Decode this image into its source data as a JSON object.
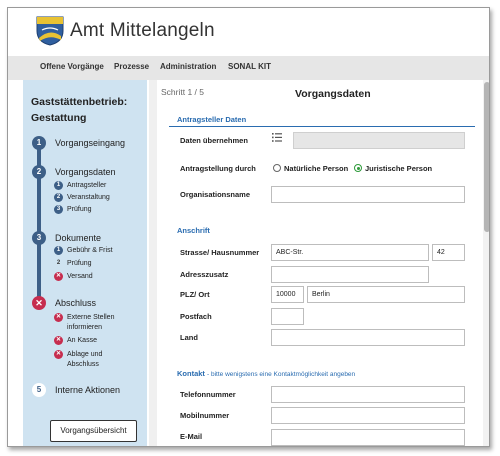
{
  "header": {
    "title": "Amt Mittelangeln"
  },
  "nav": [
    "Offene Vorgänge",
    "Prozesse",
    "Administration",
    "SONAL KIT"
  ],
  "sidebar": {
    "title": "Gaststättenbetrieb: Gestattung",
    "steps": [
      {
        "num": "1",
        "label": "Vorgangseingang"
      },
      {
        "num": "2",
        "label": "Vorgangsdaten",
        "subs": [
          {
            "badge": "1",
            "label": "Antragsteller"
          },
          {
            "badge": "2",
            "label": "Veranstaltung"
          },
          {
            "badge": "3",
            "label": "Prüfung"
          }
        ]
      },
      {
        "num": "3",
        "label": "Dokumente",
        "subs": [
          {
            "badge": "1",
            "label": "Gebühr & Frist"
          },
          {
            "badge": "2",
            "label": "Prüfung"
          },
          {
            "badge": "✕",
            "label": "Versand"
          }
        ]
      },
      {
        "num": "✕",
        "label": "Abschluss",
        "subs": [
          {
            "badge": "✕",
            "label": "Externe Stellen informieren"
          },
          {
            "badge": "✕",
            "label": "An Kasse"
          },
          {
            "badge": "✕",
            "label": "Ablage und Abschluss"
          }
        ]
      },
      {
        "num": "5",
        "label": "Interne Aktionen"
      }
    ],
    "overview_button": "Vorgangsübersicht"
  },
  "content": {
    "step_indicator": "Schritt 1 / 5",
    "title": "Vorgangsdaten",
    "sections": {
      "applicant": "Antragsteller Daten",
      "address": "Anschrift",
      "contact": "Kontakt",
      "contact_hint": "- bitte wenigstens eine Kontaktmöglichkeit angeben"
    },
    "labels": {
      "take_data": "Daten übernehmen",
      "applicant_type": "Antragstellung durch",
      "org_name": "Organisationsname",
      "street": "Strasse/ Hausnummer",
      "address_extra": "Adresszusatz",
      "plz_city": "PLZ/ Ort",
      "postbox": "Postfach",
      "country": "Land",
      "phone": "Telefonnummer",
      "mobile": "Mobilnummer",
      "email": "E-Mail"
    },
    "radio": {
      "natural": "Natürliche Person",
      "legal": "Juristische Person",
      "selected": "legal"
    },
    "values": {
      "take_data": "",
      "org_name": "",
      "street": "ABC-Str.",
      "house_no": "42",
      "address_extra": "",
      "plz": "10000",
      "city": "Berlin",
      "postbox": "",
      "country": "",
      "phone": "",
      "mobile": "",
      "email": ""
    }
  },
  "colors": {
    "accent": "#2a6cb0",
    "step": "#3d5f87",
    "error": "#c62d4f",
    "sidebar_bg": "#cfe3f1"
  }
}
